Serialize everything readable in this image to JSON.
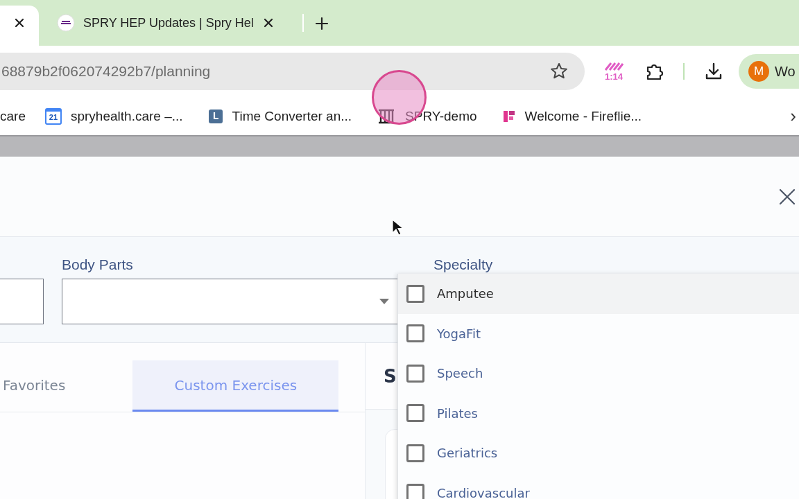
{
  "browser": {
    "tabs": [
      {
        "selected": true
      },
      {
        "title": "SPRY HEP Updates | Spry Hel",
        "selected": false
      }
    ],
    "address": "68879b2f062074292b7/planning",
    "extension_badge": "1:14",
    "profile": {
      "initial": "M",
      "label": "Wo"
    },
    "bookmarks": [
      {
        "kind": "plain",
        "label": "care"
      },
      {
        "kind": "calendar",
        "icon_text": "21",
        "label": "spryhealth.care –..."
      },
      {
        "kind": "clock",
        "label": "Time Converter an..."
      },
      {
        "kind": "spry",
        "label": "SPRY-demo"
      },
      {
        "kind": "fireflies",
        "label": "Welcome - Fireflie..."
      }
    ],
    "bookmarks_more": "›"
  },
  "filters": {
    "body_parts": {
      "label": "Body Parts"
    },
    "specialty": {
      "label": "Specialty",
      "options": [
        {
          "label": "Amputee",
          "checked": false,
          "highlighted": true
        },
        {
          "label": "YogaFit",
          "checked": false,
          "highlighted": false
        },
        {
          "label": "Speech",
          "checked": false,
          "highlighted": false
        },
        {
          "label": "Pilates",
          "checked": false,
          "highlighted": false
        },
        {
          "label": "Geriatrics",
          "checked": false,
          "highlighted": false
        },
        {
          "label": "Cardiovascular",
          "checked": false,
          "highlighted": false
        }
      ]
    }
  },
  "tabs": [
    {
      "label": "Favorites",
      "selected": false
    },
    {
      "label": "Custom Exercises",
      "selected": true
    }
  ],
  "panel_heading": "S"
}
